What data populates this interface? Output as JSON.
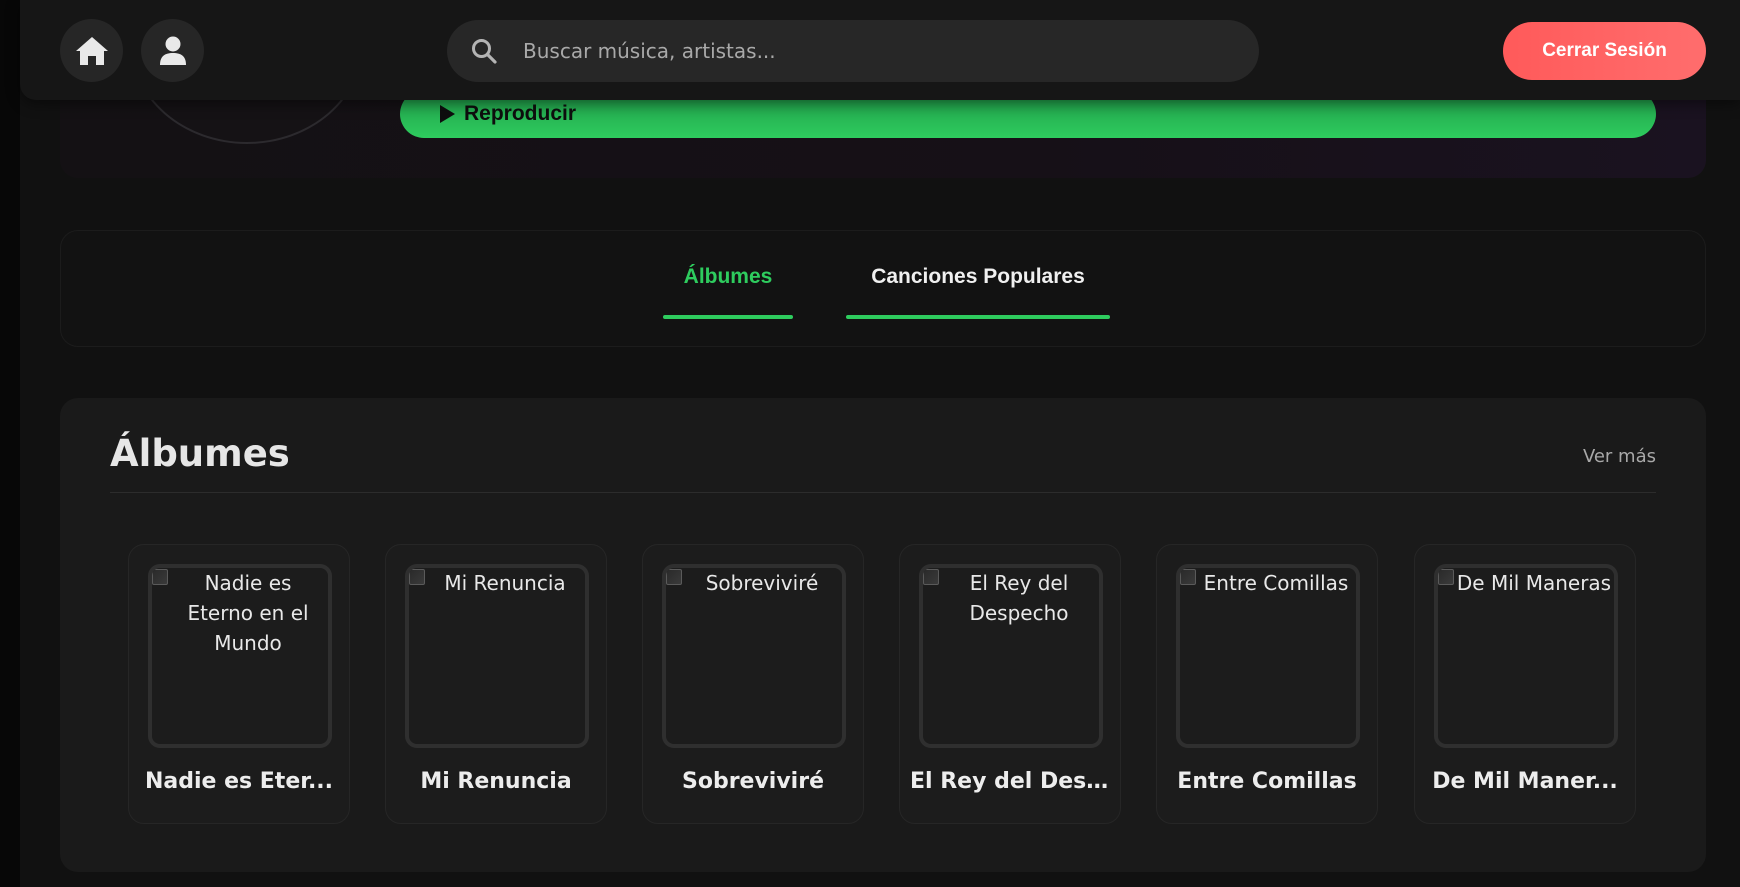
{
  "hero": {
    "play_label": "Reproducir"
  },
  "topbar": {
    "search_placeholder": "Buscar música, artistas...",
    "logout_label": "Cerrar Sesión"
  },
  "tabs": [
    {
      "label": "Álbumes",
      "active": true
    },
    {
      "label": "Canciones Populares",
      "active": false
    }
  ],
  "albums_section": {
    "title": "Álbumes",
    "see_more": "Ver más",
    "albums": [
      {
        "alt": "Nadie es Eterno en el Mundo",
        "title": "Nadie es Eter..."
      },
      {
        "alt": "Mi Renuncia",
        "title": "Mi Renuncia"
      },
      {
        "alt": "Sobreviviré",
        "title": "Sobreviviré"
      },
      {
        "alt": "El Rey del Despecho",
        "title": "El Rey del Des..."
      },
      {
        "alt": "Entre Comillas",
        "title": "Entre Comillas"
      },
      {
        "alt": "De Mil Maneras",
        "title": "De Mil Maner..."
      }
    ]
  },
  "colors": {
    "accent_green": "#2ecc5e",
    "logout_red": "#ff5a5a",
    "background": "#111111"
  },
  "icons": {
    "home": "home-icon",
    "user": "user-icon",
    "search": "search-icon",
    "play": "play-icon"
  }
}
